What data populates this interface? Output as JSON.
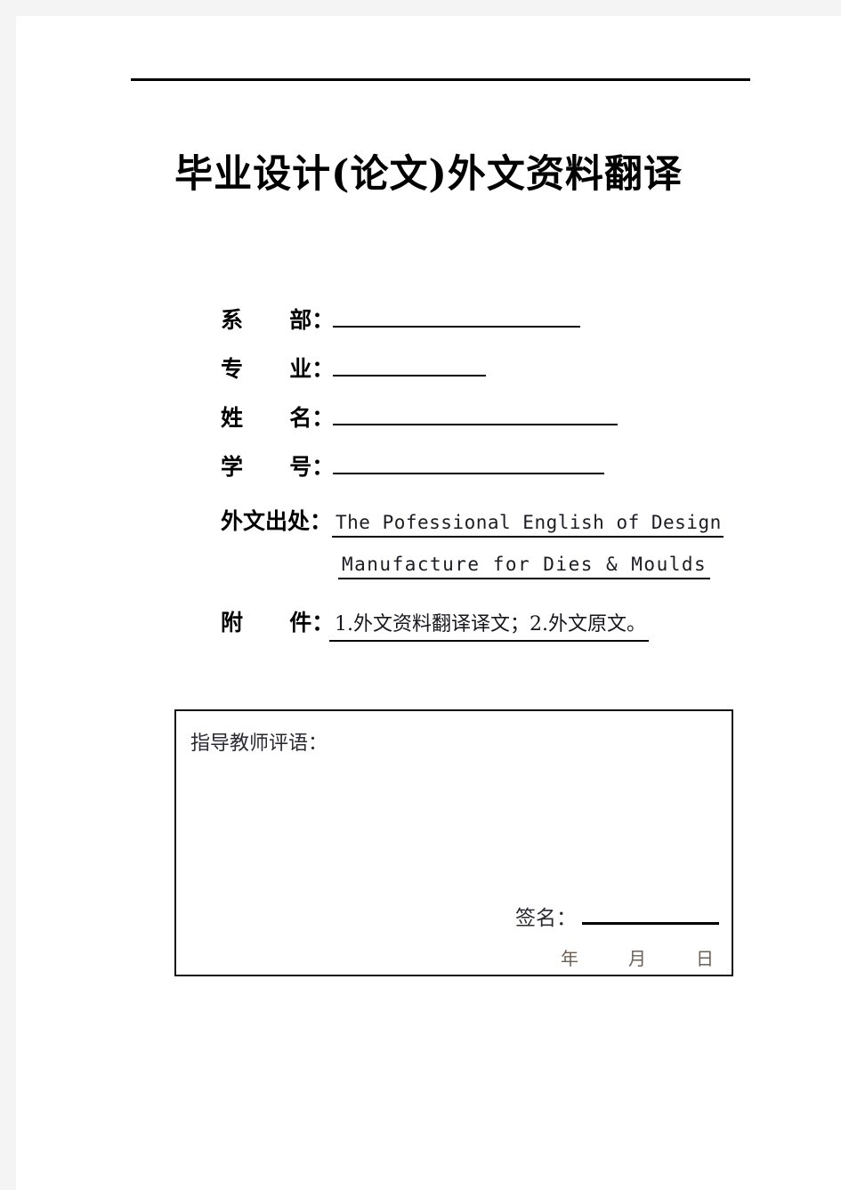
{
  "document": {
    "title": "毕业设计(论文)外文资料翻译",
    "header_rule": true
  },
  "form": {
    "fields": [
      {
        "label": "系      部：",
        "value": "",
        "line_width": "w-dept"
      },
      {
        "label": "专      业：",
        "value": "",
        "line_width": "w-major"
      },
      {
        "label": "姓      名：",
        "value": "",
        "line_width": "w-name"
      },
      {
        "label": "学      号：",
        "value": "",
        "line_width": "w-id"
      }
    ]
  },
  "source": {
    "label": "外文出处：",
    "line1": "The Pofessional English of Design",
    "line2": "Manufacture for Dies & Moulds"
  },
  "attachment": {
    "label": "附      件：",
    "value": "1.外文资料翻译译文；2.外文原文。"
  },
  "comment_box": {
    "title": "指导教师评语：",
    "signature_label": "签名：",
    "date_units": [
      "年",
      "月",
      "日"
    ]
  },
  "colors": {
    "ink": "#000000",
    "soft_ink": "#2a2a33",
    "date_ink": "#6b5f55",
    "paper": "#ffffff",
    "scan_edge": "#f4f4f4"
  }
}
